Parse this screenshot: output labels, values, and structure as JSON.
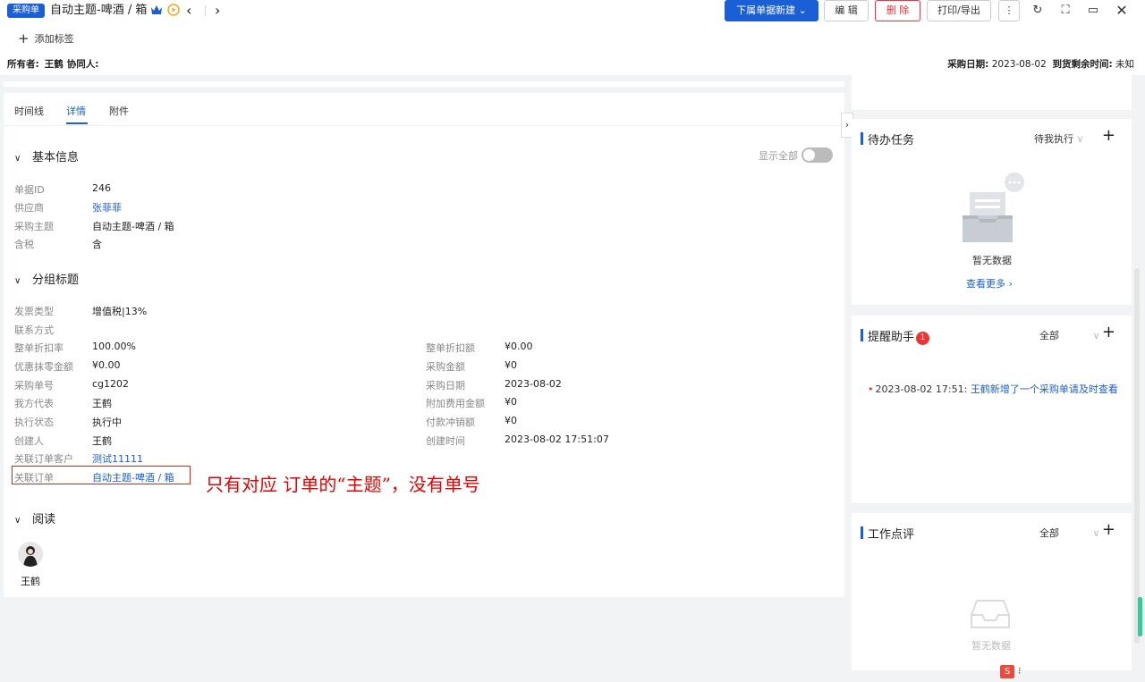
{
  "header": {
    "badge": "采购单",
    "title": "自动主题-啤酒 / 箱",
    "new_sub_label": "下属单据新建",
    "edit_label": "编 辑",
    "delete_label": "删 除",
    "print_label": "打印/导出",
    "add_tag_label": "添加标签",
    "owner_label": "所有者:",
    "owner_value": "王鹤",
    "collab_label": "协同人:",
    "purchase_date_label": "采购日期:",
    "purchase_date_value": "2023-08-02",
    "remaining_label": "到货剩余时间:",
    "remaining_value": "未知"
  },
  "tabs": [
    "时间线",
    "详情",
    "附件"
  ],
  "active_tab": "详情",
  "show_all_label": "显示全部",
  "sections": {
    "basic": {
      "title": "基本信息",
      "fields": [
        {
          "label": "单据ID",
          "value": "246"
        },
        {
          "label": "供应商",
          "value": "张菲菲",
          "link": true
        },
        {
          "label": "采购主题",
          "value": "自动主题-啤酒 / 箱"
        },
        {
          "label": "含税",
          "value": "含"
        }
      ]
    },
    "group": {
      "title": "分组标题",
      "fields_full": [
        {
          "label": "发票类型",
          "value": "增值税|13%"
        },
        {
          "label": "联系方式",
          "value": ""
        }
      ],
      "left": [
        {
          "label": "整单折扣率",
          "value": "100.00%"
        },
        {
          "label": "优惠抹零金额",
          "value": "¥0.00"
        },
        {
          "label": "采购单号",
          "value": "cg1202"
        },
        {
          "label": "我方代表",
          "value": "王鹤"
        },
        {
          "label": "执行状态",
          "value": "执行中"
        },
        {
          "label": "创建人",
          "value": "王鹤"
        },
        {
          "label": "关联订单客户",
          "value": "测试11111",
          "link": true
        },
        {
          "label": "关联订单",
          "value": "自动主题-啤酒 / 箱",
          "link": true
        }
      ],
      "right": [
        {
          "label": "整单折扣额",
          "value": "¥0.00"
        },
        {
          "label": "采购金额",
          "value": "¥0"
        },
        {
          "label": "采购日期",
          "value": "2023-08-02"
        },
        {
          "label": "附加费用金额",
          "value": "¥0"
        },
        {
          "label": "付款冲销额",
          "value": "¥0"
        },
        {
          "label": "创建时间",
          "value": "2023-08-02 17:51:07"
        }
      ]
    },
    "read": {
      "title": "阅读",
      "user": "王鹤"
    }
  },
  "annotation": "只有对应 订单的“主题”，没有单号",
  "todo_card": {
    "title": "待办任务",
    "filter": "待我执行",
    "empty": "暂无数据",
    "more": "查看更多"
  },
  "reminder_card": {
    "title": "提醒助手",
    "badge": "1",
    "filter": "全部",
    "item_time": "2023-08-02 17:51:",
    "item_text": "王鹤新增了一个采购单请及时查看"
  },
  "review_card": {
    "title": "工作点评",
    "filter": "全部",
    "empty": "暂无数据"
  },
  "colors": {
    "primary": "#1a5fd6",
    "danger": "#e33333",
    "annotation": "#e00000"
  }
}
